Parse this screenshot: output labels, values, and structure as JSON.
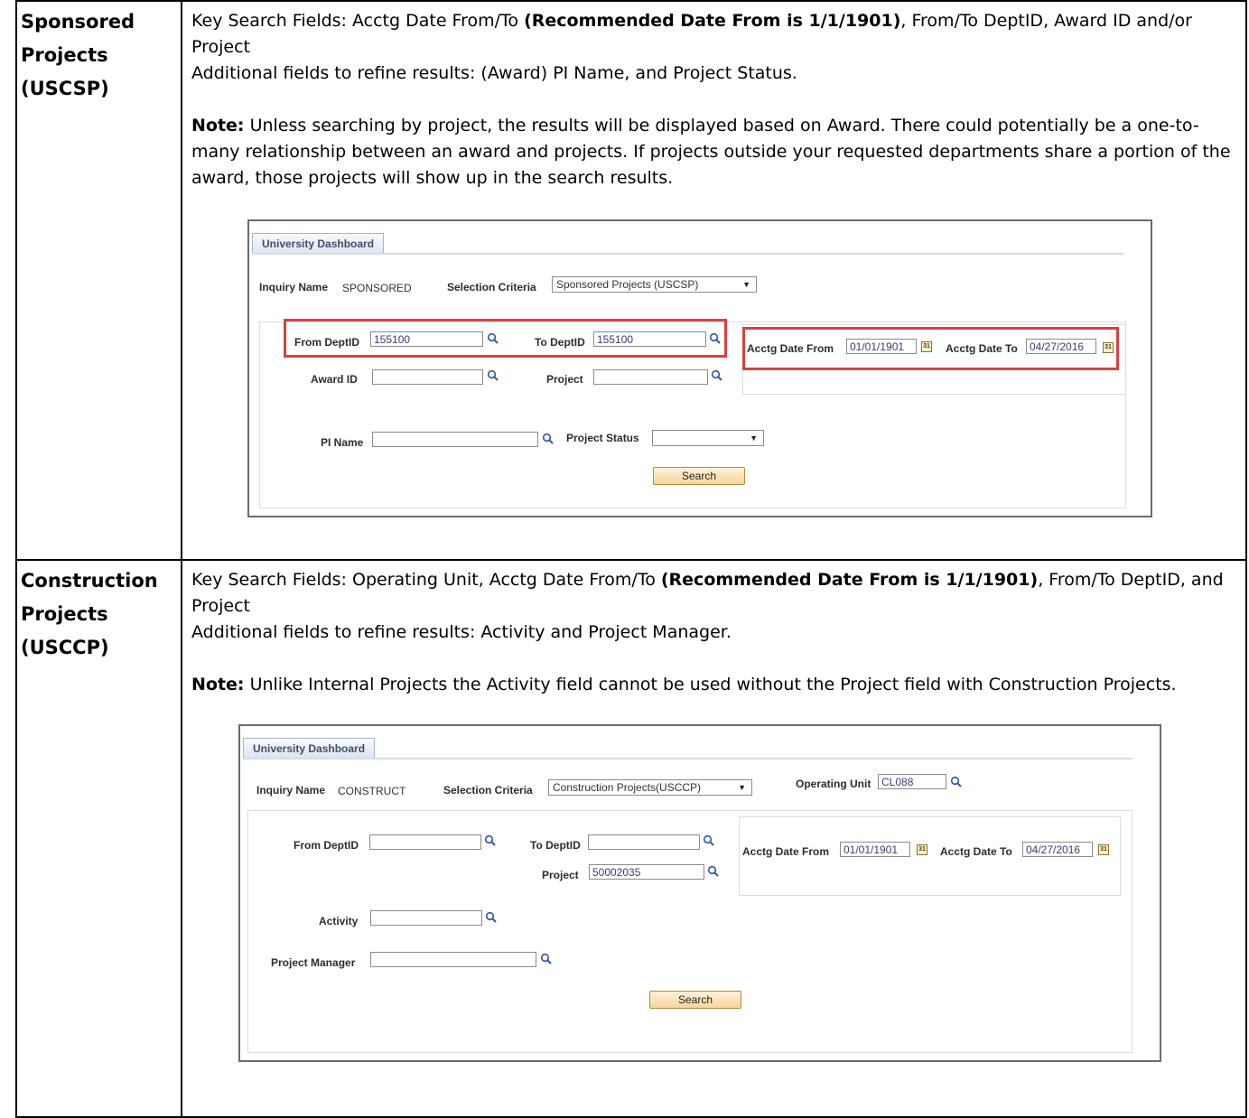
{
  "rows": [
    {
      "label_lines": [
        "Sponsored",
        "Projects",
        "(USCSP)"
      ],
      "key_prefix": "Key Search Fields:  Acctg Date From/To ",
      "key_bold": "(Recommended Date From is 1/1/1901)",
      "key_suffix": ", From/To DeptID, Award ID and/or Project",
      "additional": "Additional fields to refine results: (Award) PI Name, and Project Status.",
      "note_label": "Note:",
      "note_text": " Unless searching by project, the results will be displayed based on Award. There could potentially be a one-to-many relationship between an award and projects. If projects outside your requested departments share a portion of the award, those projects will show up in the search results.",
      "dashboard": {
        "tab": "University Dashboard",
        "inquiry_label": "Inquiry Name",
        "inquiry_value": "SPONSORED",
        "criteria_label": "Selection Criteria",
        "criteria_value": "Sponsored Projects (USCSP)",
        "from_dept_label": "From DeptID",
        "from_dept_value": "155100",
        "to_dept_label": "To DeptID",
        "to_dept_value": "155100",
        "award_label": "Award ID",
        "project_label": "Project",
        "pi_label": "PI Name",
        "status_label": "Project Status",
        "date_from_label": "Acctg Date From",
        "date_from_value": "01/01/1901",
        "date_to_label": "Acctg Date To",
        "date_to_value": "04/27/2016",
        "search_label": "Search"
      }
    },
    {
      "label_lines": [
        "Construction",
        "Projects",
        "(USCCP)"
      ],
      "key_prefix": "Key Search Fields:  Operating Unit, Acctg Date From/To ",
      "key_bold": "(Recommended Date From is 1/1/1901)",
      "key_suffix": ", From/To DeptID, and Project",
      "additional": "Additional fields to refine results: Activity and Project Manager.",
      "note_label": "Note:",
      "note_text": " Unlike Internal Projects the Activity field cannot be used without the Project field with Construction Projects.",
      "dashboard": {
        "tab": "University Dashboard",
        "inquiry_label": "Inquiry Name",
        "inquiry_value": "CONSTRUCT",
        "criteria_label": "Selection Criteria",
        "criteria_value": "Construction Projects(USCCP)",
        "op_unit_label": "Operating Unit",
        "op_unit_value": "CL088",
        "from_dept_label": "From DeptID",
        "to_dept_label": "To DeptID",
        "project_label": "Project",
        "project_value": "50002035",
        "activity_label": "Activity",
        "manager_label": "Project Manager",
        "date_from_label": "Acctg Date From",
        "date_from_value": "01/01/1901",
        "date_to_label": "Acctg Date To",
        "date_to_value": "04/27/2016",
        "search_label": "Search"
      }
    }
  ],
  "icons": {
    "lookup": "magnifier-icon",
    "calendar": "calendar-icon",
    "calendar_glyph": "31",
    "dropdown": "chevron-down-icon"
  }
}
